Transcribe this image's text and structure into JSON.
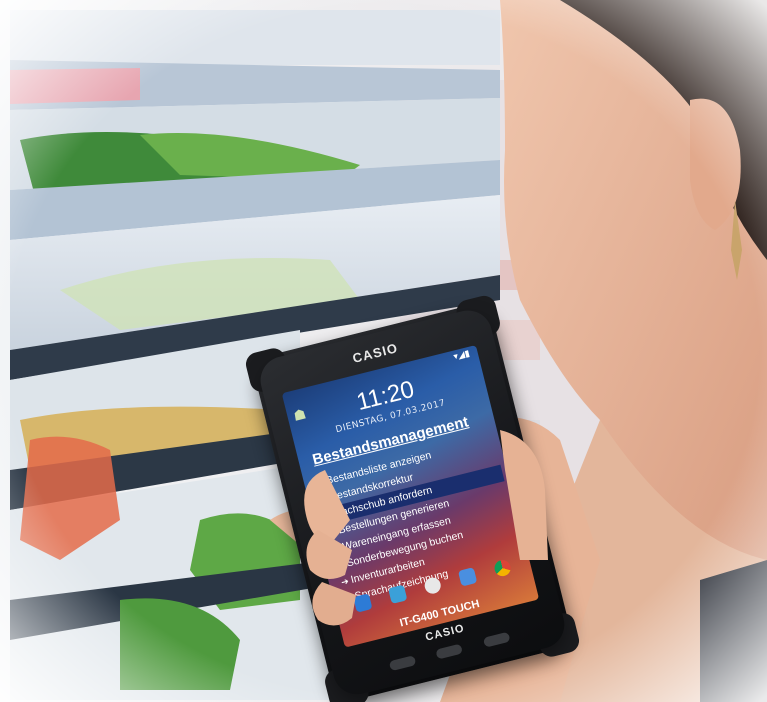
{
  "device": {
    "brand_top": "CASIO",
    "brand_bottom": "CASIO",
    "status": "▾◢▮",
    "time": "11:20",
    "date": "DIENSTAG, 07.03.2017",
    "model": "IT-G400 TOUCH"
  },
  "menu": {
    "title": "Bestandsmanagement",
    "items": [
      "Bestandsliste anzeigen",
      "Bestandskorrektur",
      "Nachschub anfordern",
      "Bestellungen generieren",
      "Wareneingang erfassen",
      "Sonderbewegung buchen",
      "Inventurarbeiten",
      "Sprachaufzeichnung"
    ],
    "selected_index": 2
  },
  "dock_icons": [
    "phone-icon",
    "contacts-icon",
    "apps-icon",
    "messages-icon",
    "chrome-icon"
  ],
  "colors": {
    "screen_top": "#1c3e7a",
    "screen_bottom": "#d7773a",
    "selected_row": "#1a2e6e"
  }
}
